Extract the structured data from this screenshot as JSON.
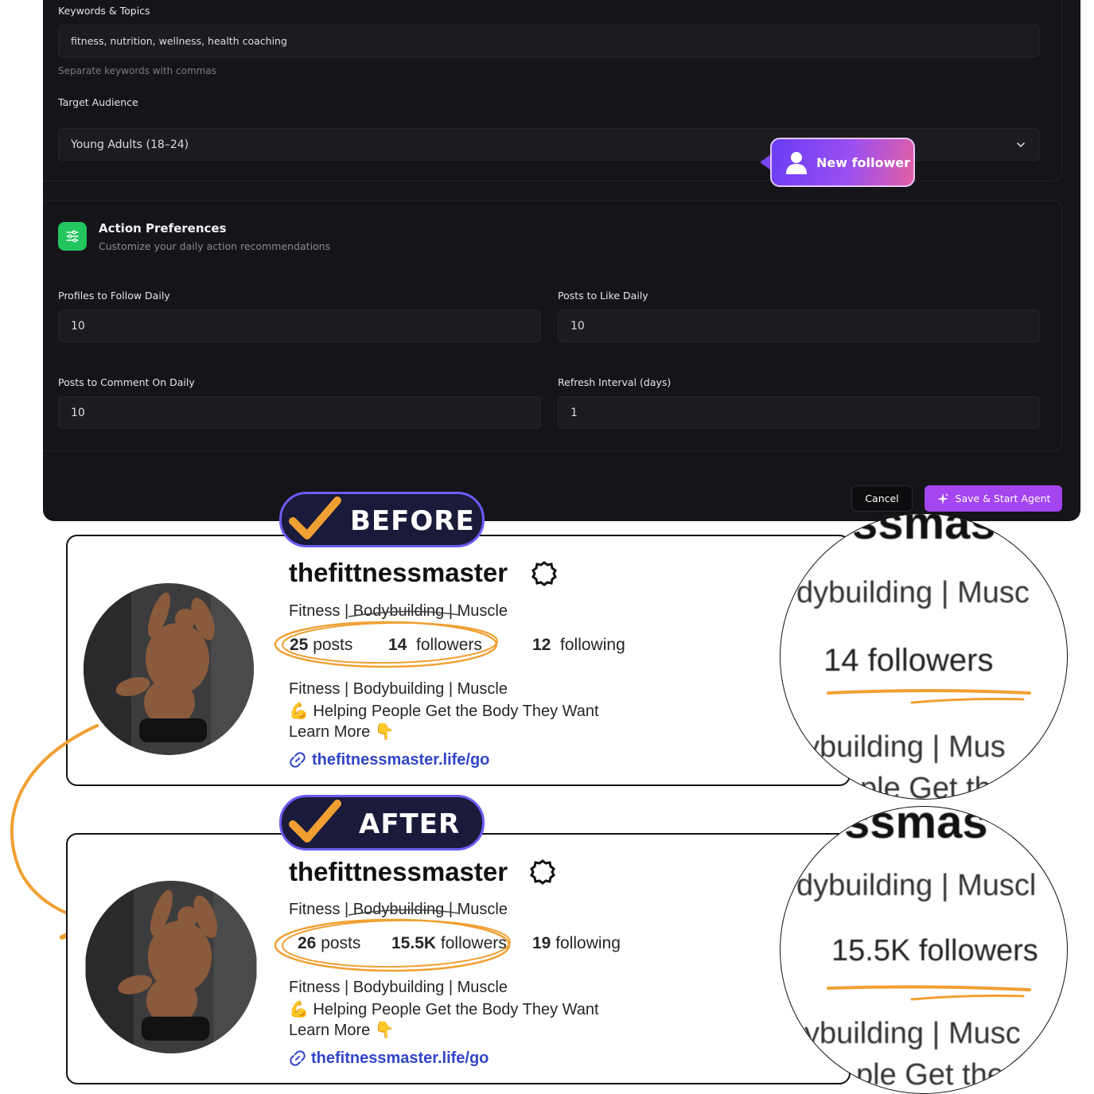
{
  "settings": {
    "keywords_label": "Keywords & Topics",
    "keywords_value": "fitness, nutrition, wellness, health coaching",
    "keywords_hint": "Separate keywords with commas",
    "audience_label": "Target Audience",
    "audience_value": "Young Adults (18–24)",
    "section_title": "Action Preferences",
    "section_subtitle": "Customize your daily action recommendations",
    "follow_label": "Profiles to Follow Daily",
    "follow_value": "10",
    "like_label": "Posts to Like Daily",
    "like_value": "10",
    "comment_label": "Posts to Comment On Daily",
    "comment_value": "10",
    "refresh_label": "Refresh Interval (days)",
    "refresh_value": "1",
    "cancel_label": "Cancel",
    "save_label": "Save & Start Agent",
    "accent_color": "#a445f0",
    "section_icon_color": "#22c55e"
  },
  "notification": {
    "label": "New follower"
  },
  "before": {
    "badge": "BEFORE",
    "username": "thefittnessmaster",
    "tagline": "Fitness | Bodybuilding | Muscle",
    "posts_count": "25",
    "posts_label": "posts",
    "followers_count": "14",
    "followers_label": "followers",
    "following_count": "12",
    "following_label": "following",
    "bio_line1": "Fitness | Bodybuilding | Muscle",
    "bio_line2": "💪 Helping People Get the Body They Want",
    "bio_line3": "Learn More 👇",
    "link": "thefitnessmaster.life/go",
    "zoom": {
      "top": "ssmas",
      "line1": "dybuilding | Musc",
      "followers": "14  followers",
      "line3": "ybuilding | Mus",
      "line4": "ple Get th"
    }
  },
  "after": {
    "badge": "AFTER",
    "username": "thefittnessmaster",
    "tagline": "Fitness | Bodybuilding | Muscle",
    "posts_count": "26",
    "posts_label": "posts",
    "followers_count": "15.5K",
    "followers_label": "followers",
    "following_count": "19",
    "following_label": "following",
    "bio_line1": "Fitness | Bodybuilding | Muscle",
    "bio_line2": "💪 Helping People Get the Body They Want",
    "bio_line3": "Learn More 👇",
    "link": "thefitnessmaster.life/go",
    "zoom": {
      "top": "ssmas",
      "line1": "dybuilding | Muscl",
      "followers": "15.5K followers",
      "line3": "ybuilding | Musc",
      "line4": "ple Get the"
    }
  },
  "annotation_color": "#f0a032"
}
